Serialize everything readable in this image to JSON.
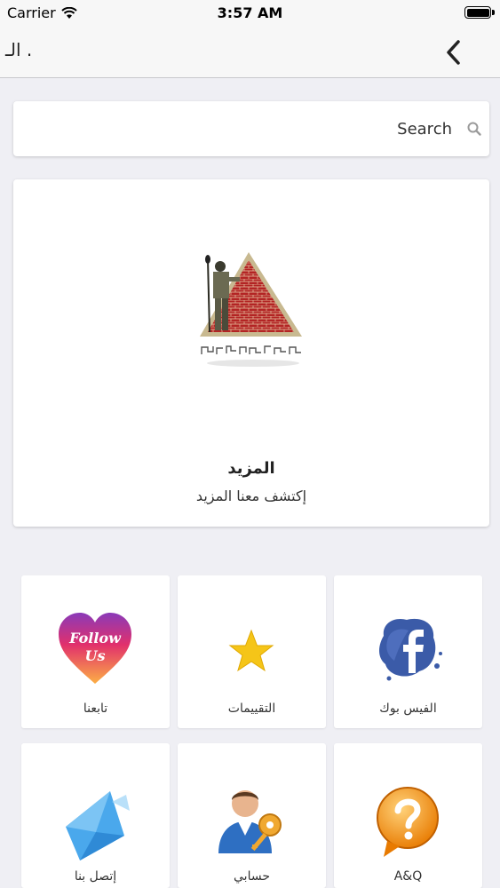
{
  "status_bar": {
    "carrier": "Carrier",
    "time": "3:57 AM"
  },
  "nav": {
    "title": "الـ .",
    "back_icon": "chevron-left-icon"
  },
  "search": {
    "placeholder": "Search",
    "icon": "search-icon"
  },
  "hero": {
    "logo": "pyramid-warrior-logo",
    "title": "المزيد",
    "subtitle": "إكتشف معنا المزيد"
  },
  "tiles": [
    {
      "label": "تابعنا",
      "icon": "follow-us-heart-icon",
      "icon_text_1": "Follow",
      "icon_text_2": "Us"
    },
    {
      "label": "التقييمات",
      "icon": "star-icon"
    },
    {
      "label": "الفيس بوك",
      "icon": "facebook-icon"
    },
    {
      "label": "إتصل بنا",
      "icon": "envelope-icon"
    },
    {
      "label": "حسابي",
      "icon": "user-key-icon"
    },
    {
      "label": "A&Q",
      "icon": "question-mark-icon"
    }
  ],
  "colors": {
    "background": "#efeff4",
    "star": "#f5c518",
    "facebook": "#3b5ba8",
    "question": "#f08a00",
    "envelope": "#3aa0e8"
  }
}
